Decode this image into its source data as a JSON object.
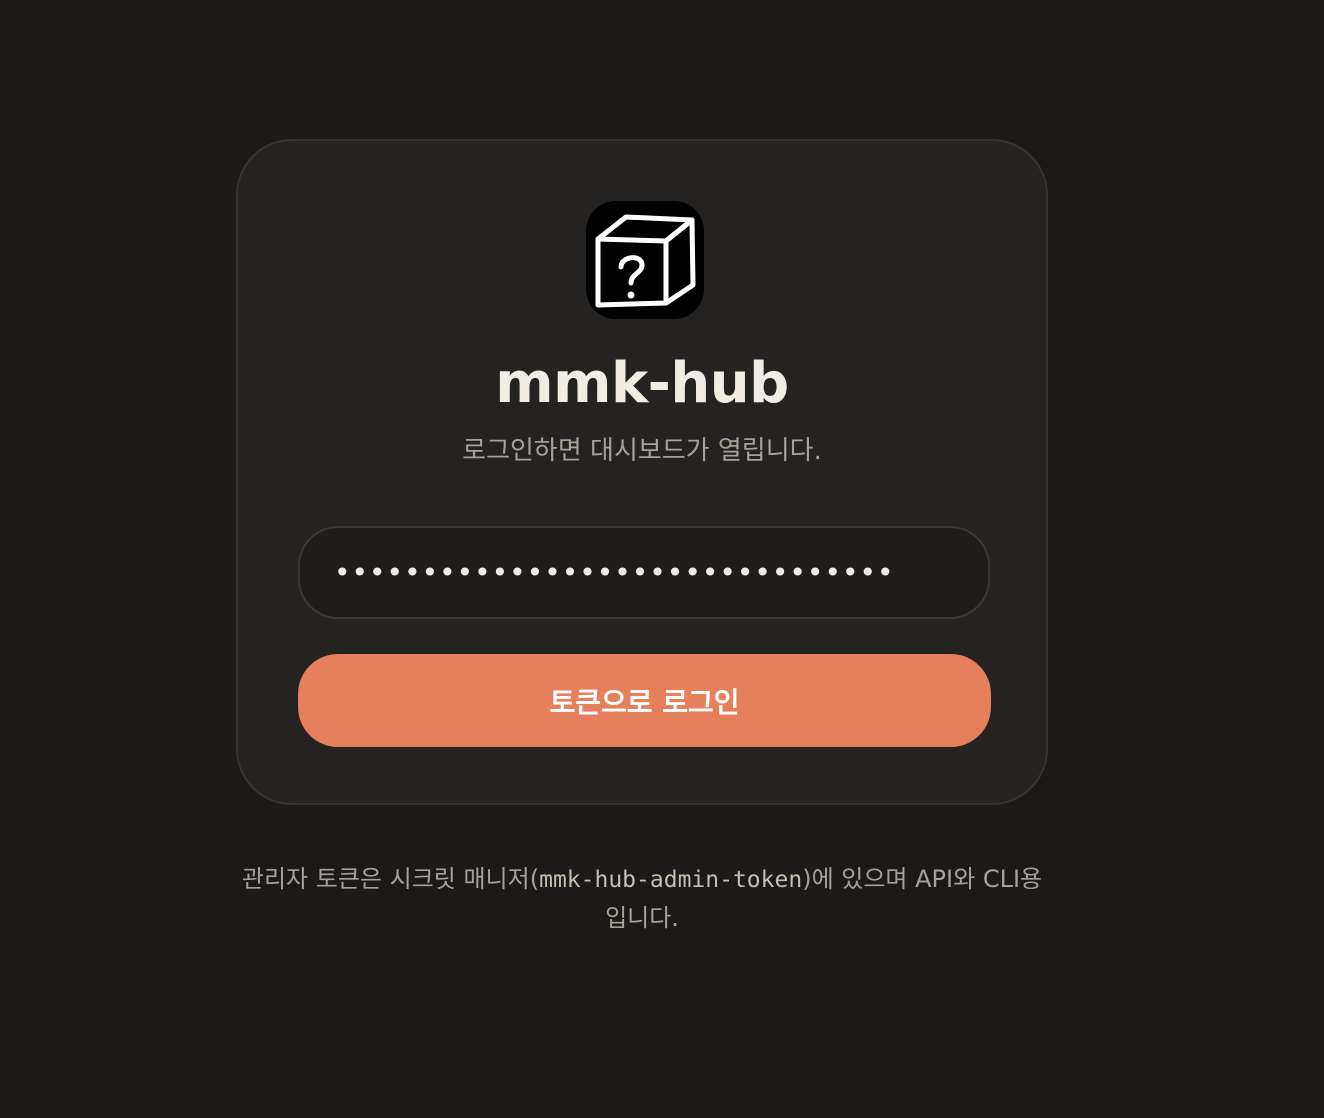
{
  "brand": {
    "name": "mmk-hub",
    "logo_icon": "question-box-icon"
  },
  "login": {
    "subtitle": "로그인하면 대시보드가 열립니다.",
    "token_value": "••••••••••••••••••••••••••••••••",
    "button_label": "토큰으로 로그인"
  },
  "footnote": {
    "before": "관리자 토큰은 시크릿 매니저(",
    "secret_name": "mmk-hub-admin-token",
    "after": ")에 있으며 API와 CLI용입니다."
  },
  "colors": {
    "background": "#1b1a18",
    "card": "#242321",
    "accent": "#e57f5c",
    "text": "#f1ede4",
    "muted": "#a7a298"
  }
}
